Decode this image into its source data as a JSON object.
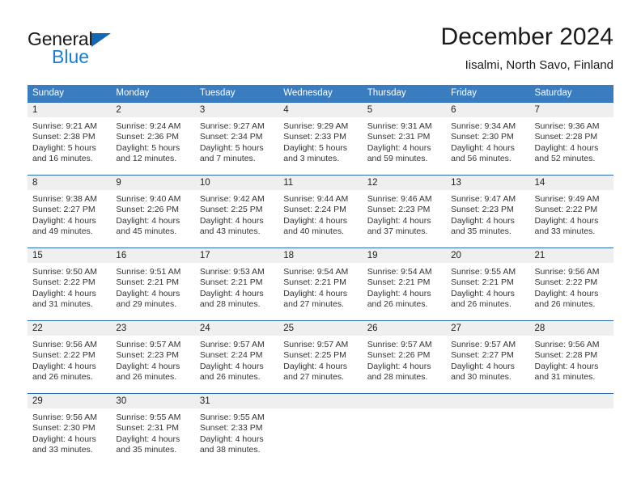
{
  "brand": {
    "name_primary": "General",
    "name_secondary": "Blue",
    "triangle_icon": "triangle-icon",
    "accent_color": "#1268b3"
  },
  "header": {
    "title": "December 2024",
    "subtitle": "Iisalmi, North Savo, Finland"
  },
  "theme": {
    "header_blue": "#3a7cc0",
    "row_rule_blue": "#2b6cb5",
    "daynum_gray": "#efefef",
    "text_color": "#333333"
  },
  "calendar": {
    "weekday_headers": [
      "Sunday",
      "Monday",
      "Tuesday",
      "Wednesday",
      "Thursday",
      "Friday",
      "Saturday"
    ],
    "weeks": [
      [
        {
          "day": "1",
          "sunrise": "Sunrise: 9:21 AM",
          "sunset": "Sunset: 2:38 PM",
          "daylight_line1": "Daylight: 5 hours",
          "daylight_line2": "and 16 minutes."
        },
        {
          "day": "2",
          "sunrise": "Sunrise: 9:24 AM",
          "sunset": "Sunset: 2:36 PM",
          "daylight_line1": "Daylight: 5 hours",
          "daylight_line2": "and 12 minutes."
        },
        {
          "day": "3",
          "sunrise": "Sunrise: 9:27 AM",
          "sunset": "Sunset: 2:34 PM",
          "daylight_line1": "Daylight: 5 hours",
          "daylight_line2": "and 7 minutes."
        },
        {
          "day": "4",
          "sunrise": "Sunrise: 9:29 AM",
          "sunset": "Sunset: 2:33 PM",
          "daylight_line1": "Daylight: 5 hours",
          "daylight_line2": "and 3 minutes."
        },
        {
          "day": "5",
          "sunrise": "Sunrise: 9:31 AM",
          "sunset": "Sunset: 2:31 PM",
          "daylight_line1": "Daylight: 4 hours",
          "daylight_line2": "and 59 minutes."
        },
        {
          "day": "6",
          "sunrise": "Sunrise: 9:34 AM",
          "sunset": "Sunset: 2:30 PM",
          "daylight_line1": "Daylight: 4 hours",
          "daylight_line2": "and 56 minutes."
        },
        {
          "day": "7",
          "sunrise": "Sunrise: 9:36 AM",
          "sunset": "Sunset: 2:28 PM",
          "daylight_line1": "Daylight: 4 hours",
          "daylight_line2": "and 52 minutes."
        }
      ],
      [
        {
          "day": "8",
          "sunrise": "Sunrise: 9:38 AM",
          "sunset": "Sunset: 2:27 PM",
          "daylight_line1": "Daylight: 4 hours",
          "daylight_line2": "and 49 minutes."
        },
        {
          "day": "9",
          "sunrise": "Sunrise: 9:40 AM",
          "sunset": "Sunset: 2:26 PM",
          "daylight_line1": "Daylight: 4 hours",
          "daylight_line2": "and 45 minutes."
        },
        {
          "day": "10",
          "sunrise": "Sunrise: 9:42 AM",
          "sunset": "Sunset: 2:25 PM",
          "daylight_line1": "Daylight: 4 hours",
          "daylight_line2": "and 43 minutes."
        },
        {
          "day": "11",
          "sunrise": "Sunrise: 9:44 AM",
          "sunset": "Sunset: 2:24 PM",
          "daylight_line1": "Daylight: 4 hours",
          "daylight_line2": "and 40 minutes."
        },
        {
          "day": "12",
          "sunrise": "Sunrise: 9:46 AM",
          "sunset": "Sunset: 2:23 PM",
          "daylight_line1": "Daylight: 4 hours",
          "daylight_line2": "and 37 minutes."
        },
        {
          "day": "13",
          "sunrise": "Sunrise: 9:47 AM",
          "sunset": "Sunset: 2:23 PM",
          "daylight_line1": "Daylight: 4 hours",
          "daylight_line2": "and 35 minutes."
        },
        {
          "day": "14",
          "sunrise": "Sunrise: 9:49 AM",
          "sunset": "Sunset: 2:22 PM",
          "daylight_line1": "Daylight: 4 hours",
          "daylight_line2": "and 33 minutes."
        }
      ],
      [
        {
          "day": "15",
          "sunrise": "Sunrise: 9:50 AM",
          "sunset": "Sunset: 2:22 PM",
          "daylight_line1": "Daylight: 4 hours",
          "daylight_line2": "and 31 minutes."
        },
        {
          "day": "16",
          "sunrise": "Sunrise: 9:51 AM",
          "sunset": "Sunset: 2:21 PM",
          "daylight_line1": "Daylight: 4 hours",
          "daylight_line2": "and 29 minutes."
        },
        {
          "day": "17",
          "sunrise": "Sunrise: 9:53 AM",
          "sunset": "Sunset: 2:21 PM",
          "daylight_line1": "Daylight: 4 hours",
          "daylight_line2": "and 28 minutes."
        },
        {
          "day": "18",
          "sunrise": "Sunrise: 9:54 AM",
          "sunset": "Sunset: 2:21 PM",
          "daylight_line1": "Daylight: 4 hours",
          "daylight_line2": "and 27 minutes."
        },
        {
          "day": "19",
          "sunrise": "Sunrise: 9:54 AM",
          "sunset": "Sunset: 2:21 PM",
          "daylight_line1": "Daylight: 4 hours",
          "daylight_line2": "and 26 minutes."
        },
        {
          "day": "20",
          "sunrise": "Sunrise: 9:55 AM",
          "sunset": "Sunset: 2:21 PM",
          "daylight_line1": "Daylight: 4 hours",
          "daylight_line2": "and 26 minutes."
        },
        {
          "day": "21",
          "sunrise": "Sunrise: 9:56 AM",
          "sunset": "Sunset: 2:22 PM",
          "daylight_line1": "Daylight: 4 hours",
          "daylight_line2": "and 26 minutes."
        }
      ],
      [
        {
          "day": "22",
          "sunrise": "Sunrise: 9:56 AM",
          "sunset": "Sunset: 2:22 PM",
          "daylight_line1": "Daylight: 4 hours",
          "daylight_line2": "and 26 minutes."
        },
        {
          "day": "23",
          "sunrise": "Sunrise: 9:57 AM",
          "sunset": "Sunset: 2:23 PM",
          "daylight_line1": "Daylight: 4 hours",
          "daylight_line2": "and 26 minutes."
        },
        {
          "day": "24",
          "sunrise": "Sunrise: 9:57 AM",
          "sunset": "Sunset: 2:24 PM",
          "daylight_line1": "Daylight: 4 hours",
          "daylight_line2": "and 26 minutes."
        },
        {
          "day": "25",
          "sunrise": "Sunrise: 9:57 AM",
          "sunset": "Sunset: 2:25 PM",
          "daylight_line1": "Daylight: 4 hours",
          "daylight_line2": "and 27 minutes."
        },
        {
          "day": "26",
          "sunrise": "Sunrise: 9:57 AM",
          "sunset": "Sunset: 2:26 PM",
          "daylight_line1": "Daylight: 4 hours",
          "daylight_line2": "and 28 minutes."
        },
        {
          "day": "27",
          "sunrise": "Sunrise: 9:57 AM",
          "sunset": "Sunset: 2:27 PM",
          "daylight_line1": "Daylight: 4 hours",
          "daylight_line2": "and 30 minutes."
        },
        {
          "day": "28",
          "sunrise": "Sunrise: 9:56 AM",
          "sunset": "Sunset: 2:28 PM",
          "daylight_line1": "Daylight: 4 hours",
          "daylight_line2": "and 31 minutes."
        }
      ],
      [
        {
          "day": "29",
          "sunrise": "Sunrise: 9:56 AM",
          "sunset": "Sunset: 2:30 PM",
          "daylight_line1": "Daylight: 4 hours",
          "daylight_line2": "and 33 minutes."
        },
        {
          "day": "30",
          "sunrise": "Sunrise: 9:55 AM",
          "sunset": "Sunset: 2:31 PM",
          "daylight_line1": "Daylight: 4 hours",
          "daylight_line2": "and 35 minutes."
        },
        {
          "day": "31",
          "sunrise": "Sunrise: 9:55 AM",
          "sunset": "Sunset: 2:33 PM",
          "daylight_line1": "Daylight: 4 hours",
          "daylight_line2": "and 38 minutes."
        },
        {
          "day": "",
          "sunrise": "",
          "sunset": "",
          "daylight_line1": "",
          "daylight_line2": ""
        },
        {
          "day": "",
          "sunrise": "",
          "sunset": "",
          "daylight_line1": "",
          "daylight_line2": ""
        },
        {
          "day": "",
          "sunrise": "",
          "sunset": "",
          "daylight_line1": "",
          "daylight_line2": ""
        },
        {
          "day": "",
          "sunrise": "",
          "sunset": "",
          "daylight_line1": "",
          "daylight_line2": ""
        }
      ]
    ]
  }
}
